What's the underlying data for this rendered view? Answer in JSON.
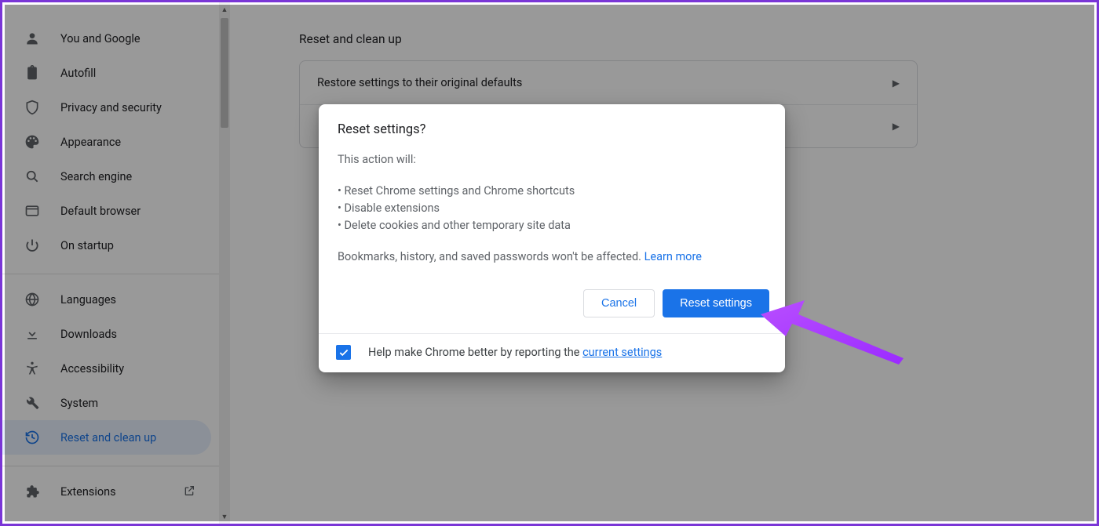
{
  "sidebar": {
    "group1": [
      {
        "icon": "person",
        "label": "You and Google"
      },
      {
        "icon": "clipboard",
        "label": "Autofill"
      },
      {
        "icon": "shield",
        "label": "Privacy and security"
      },
      {
        "icon": "palette",
        "label": "Appearance"
      },
      {
        "icon": "search",
        "label": "Search engine"
      },
      {
        "icon": "browser",
        "label": "Default browser"
      },
      {
        "icon": "power",
        "label": "On startup"
      }
    ],
    "group2": [
      {
        "icon": "globe",
        "label": "Languages"
      },
      {
        "icon": "download",
        "label": "Downloads"
      },
      {
        "icon": "accessibility",
        "label": "Accessibility"
      },
      {
        "icon": "wrench",
        "label": "System"
      },
      {
        "icon": "history",
        "label": "Reset and clean up",
        "active": true
      }
    ],
    "group3": [
      {
        "icon": "extension",
        "label": "Extensions",
        "external": true
      }
    ]
  },
  "main": {
    "section_title": "Reset and clean up",
    "rows": [
      "Restore settings to their original defaults",
      ""
    ]
  },
  "dialog": {
    "title": "Reset settings?",
    "intro": "This action will:",
    "bullets": [
      "Reset Chrome settings and Chrome shortcuts",
      "Disable extensions",
      "Delete cookies and other temporary site data"
    ],
    "note_prefix": "Bookmarks, history, and saved passwords won't be affected.",
    "learn_more": " Learn more",
    "cancel": "Cancel",
    "confirm": "Reset settings",
    "footer_prefix": "Help make Chrome better by reporting the ",
    "footer_link": "current settings"
  }
}
